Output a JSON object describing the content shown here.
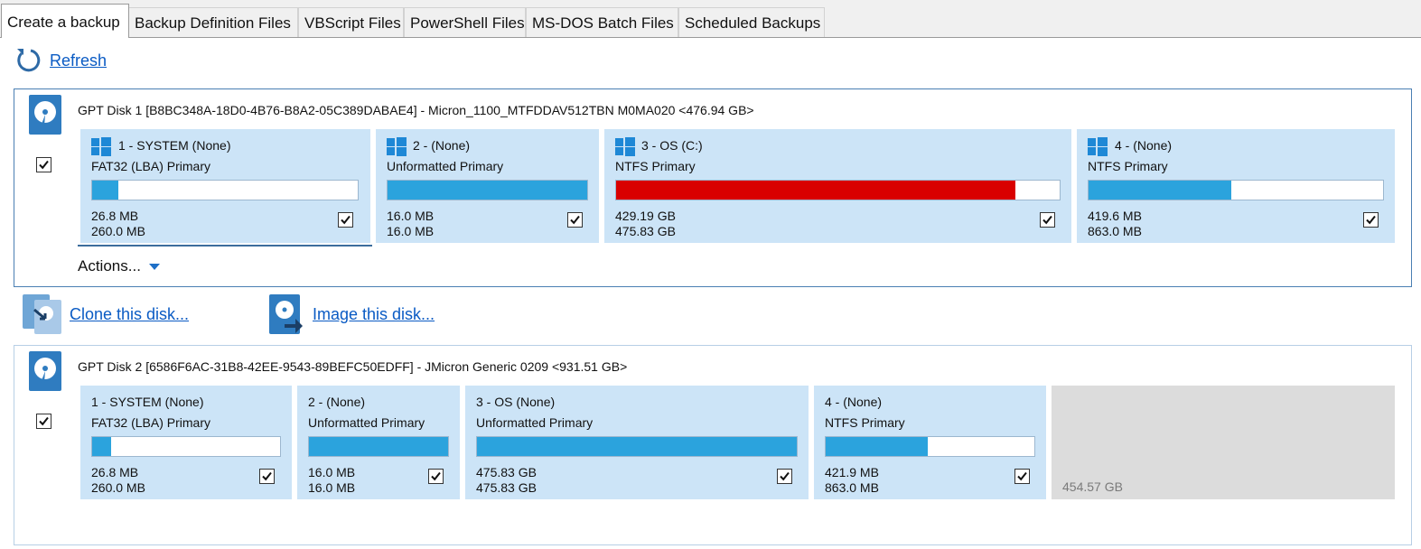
{
  "tabs": [
    {
      "label": "Create a backup",
      "active": true
    },
    {
      "label": "Backup Definition Files"
    },
    {
      "label": "VBScript Files"
    },
    {
      "label": "PowerShell Files"
    },
    {
      "label": "MS-DOS Batch Files"
    },
    {
      "label": "Scheduled Backups"
    }
  ],
  "refresh_label": "Refresh",
  "colors": {
    "accent": "#2ba3dd",
    "partition_bg": "#cce4f7",
    "full": "#d90000",
    "link": "#0a5bc4"
  },
  "disk1": {
    "title": "GPT Disk 1 [B8BC348A-18D0-4B76-B8A2-05C389DABAE4] - Micron_1100_MTFDDAV512TBN  M0MA020  <476.94 GB>",
    "checked": true,
    "partitions": [
      {
        "title": "1 - SYSTEM (None)",
        "type": "FAT32 (LBA) Primary",
        "used": "26.8 MB",
        "total": "260.0 MB",
        "usage": 0.1,
        "windows_icon": true,
        "checked": true
      },
      {
        "title": "2 -  (None)",
        "type": "Unformatted Primary",
        "used": "16.0 MB",
        "total": "16.0 MB",
        "usage": 1.0,
        "windows_icon": true,
        "checked": true
      },
      {
        "title": "3 - OS (C:)",
        "type": "NTFS Primary",
        "used": "429.19 GB",
        "total": "475.83 GB",
        "usage": 0.9,
        "windows_icon": true,
        "checked": true,
        "near_full": true
      },
      {
        "title": "4 -  (None)",
        "type": "NTFS Primary",
        "used": "419.6 MB",
        "total": "863.0 MB",
        "usage": 0.486,
        "windows_icon": true,
        "checked": true
      }
    ],
    "actions_label": "Actions..."
  },
  "disk_links": {
    "clone": "Clone this disk...",
    "image": "Image this disk..."
  },
  "disk2": {
    "title": "GPT Disk 2 [6586F6AC-31B8-42EE-9543-89BEFC50EDFF] - JMicron  Generic          0209  <931.51 GB>",
    "checked": true,
    "partitions": [
      {
        "title": "1 - SYSTEM (None)",
        "type": "FAT32 (LBA) Primary",
        "used": "26.8 MB",
        "total": "260.0 MB",
        "usage": 0.1,
        "checked": true
      },
      {
        "title": "2 -  (None)",
        "type": "Unformatted Primary",
        "used": "16.0 MB",
        "total": "16.0 MB",
        "usage": 1.0,
        "checked": true
      },
      {
        "title": "3 - OS (None)",
        "type": "Unformatted Primary",
        "used": "475.83 GB",
        "total": "475.83 GB",
        "usage": 1.0,
        "checked": true
      },
      {
        "title": "4 -  (None)",
        "type": "NTFS Primary",
        "used": "421.9 MB",
        "total": "863.0 MB",
        "usage": 0.49,
        "checked": true
      }
    ],
    "unallocated": "454.57 GB"
  }
}
